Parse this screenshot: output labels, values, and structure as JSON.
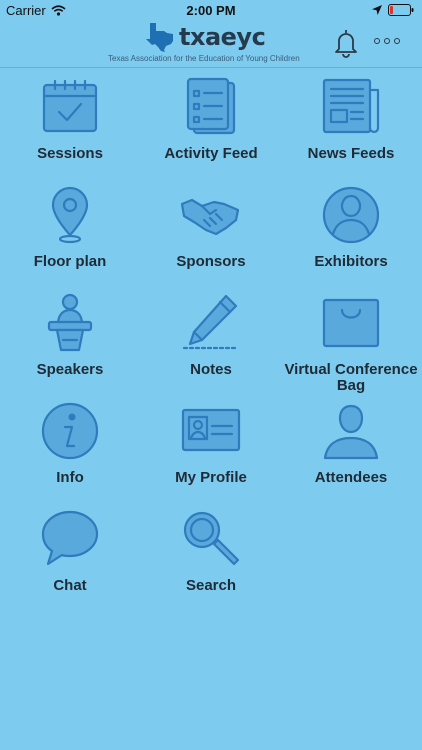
{
  "status": {
    "carrier": "Carrier",
    "time": "2:00 PM"
  },
  "header": {
    "logo_text": "txaeyc",
    "tagline": "Texas Association for the Education of Young Children",
    "notifications_icon": "bell-icon",
    "more_icon": "more-icon"
  },
  "menu": [
    {
      "label": "Sessions",
      "icon": "calendar-check-icon"
    },
    {
      "label": "Activity Feed",
      "icon": "checklist-icon"
    },
    {
      "label": "News Feeds",
      "icon": "newspaper-icon"
    },
    {
      "label": "Floor plan",
      "icon": "map-pin-icon"
    },
    {
      "label": "Sponsors",
      "icon": "handshake-icon"
    },
    {
      "label": "Exhibitors",
      "icon": "person-circle-icon"
    },
    {
      "label": "Speakers",
      "icon": "podium-icon"
    },
    {
      "label": "Notes",
      "icon": "pen-icon"
    },
    {
      "label": "Virtual Conference Bag",
      "icon": "bag-icon"
    },
    {
      "label": "Info",
      "icon": "info-icon"
    },
    {
      "label": "My Profile",
      "icon": "id-card-icon"
    },
    {
      "label": "Attendees",
      "icon": "person-icon"
    },
    {
      "label": "Chat",
      "icon": "chat-bubble-icon"
    },
    {
      "label": "Search",
      "icon": "magnifier-icon"
    }
  ],
  "colors": {
    "background": "#7ecbf0",
    "icon_fill": "#5aa9dc",
    "icon_stroke": "#2f7bbd",
    "text": "#1f2b36"
  }
}
